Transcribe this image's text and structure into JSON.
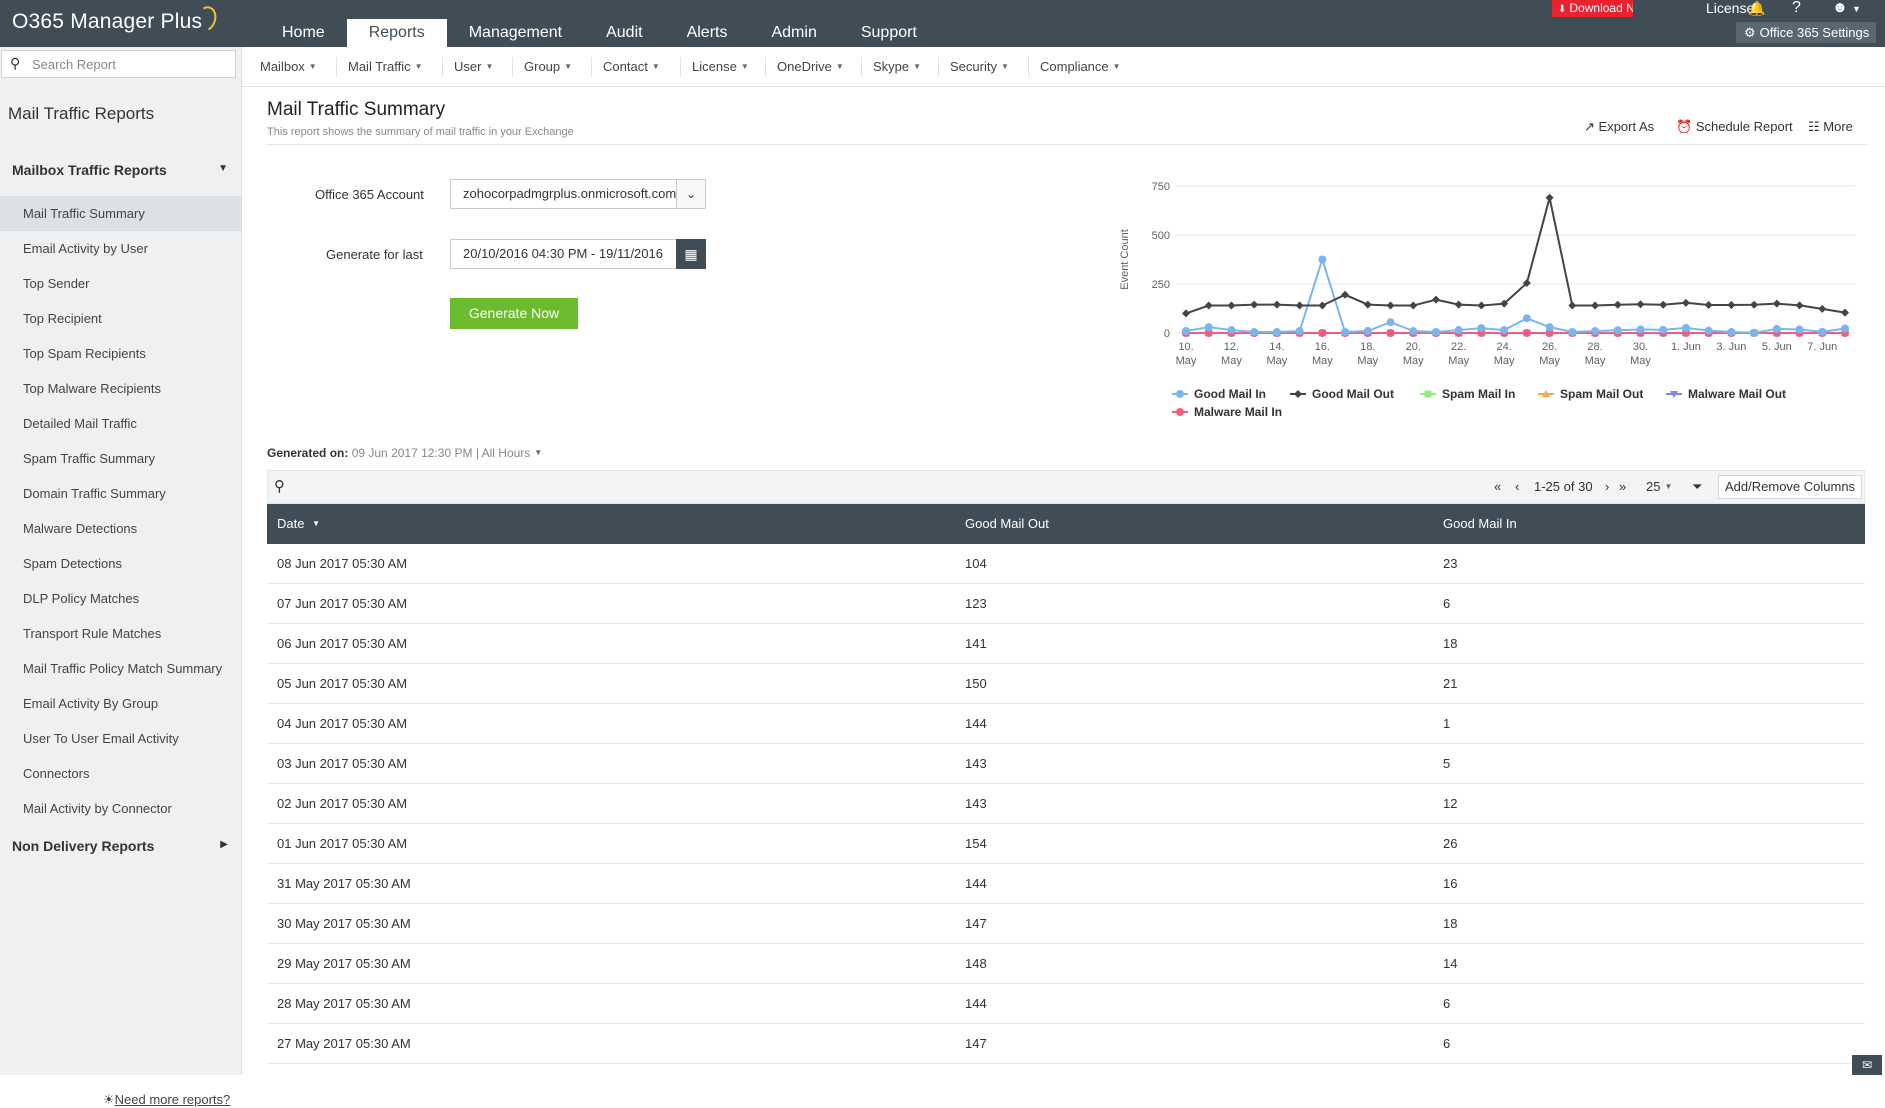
{
  "app": {
    "title": "O365 Manager Plus"
  },
  "topnav": [
    "Home",
    "Reports",
    "Management",
    "Audit",
    "Alerts",
    "Admin",
    "Support"
  ],
  "topnav_active": 1,
  "header_right": {
    "download": "Download Now",
    "license": "License",
    "settings": "Office 365 Settings"
  },
  "subnav": [
    "Mailbox",
    "Mail Traffic",
    "User",
    "Group",
    "Contact",
    "License",
    "OneDrive",
    "Skype",
    "Security",
    "Compliance"
  ],
  "sidebar": {
    "search_placeholder": "Search Report",
    "title": "Mail Traffic Reports",
    "section1": "Mailbox Traffic Reports",
    "items": [
      "Mail Traffic Summary",
      "Email Activity by User",
      "Top Sender",
      "Top Recipient",
      "Top Spam Recipients",
      "Top Malware Recipients",
      "Detailed Mail Traffic",
      "Spam Traffic Summary",
      "Domain Traffic Summary",
      "Malware Detections",
      "Spam Detections",
      "DLP Policy Matches",
      "Transport Rule Matches",
      "Mail Traffic Policy Match Summary",
      "Email Activity By Group",
      "User To User Email Activity",
      "Connectors",
      "Mail Activity by Connector"
    ],
    "active_index": 0,
    "section2": "Non Delivery Reports",
    "need_more": "Need more reports?"
  },
  "report": {
    "title": "Mail Traffic Summary",
    "subtitle": "This report shows the summary of mail traffic in your Exchange",
    "actions": {
      "export": "Export As",
      "schedule": "Schedule Report",
      "more": "More"
    }
  },
  "form": {
    "account_label": "Office 365 Account",
    "account_value": "zohocorpadmgrplus.onmicrosoft.com",
    "period_label": "Generate for last",
    "period_value": "20/10/2016 04:30 PM - 19/11/2016",
    "generate_button": "Generate Now"
  },
  "generated": {
    "label": "Generated on:",
    "value": "09 Jun 2017 12:30 PM",
    "sep": "|",
    "hours": "All Hours"
  },
  "toolbar": {
    "range": "1-25 of 30",
    "page_size": "25",
    "add_columns": "Add/Remove Columns"
  },
  "table": {
    "columns": [
      "Date",
      "Good Mail Out",
      "Good Mail In"
    ],
    "rows": [
      [
        "08 Jun 2017 05:30 AM",
        "104",
        "23"
      ],
      [
        "07 Jun 2017 05:30 AM",
        "123",
        "6"
      ],
      [
        "06 Jun 2017 05:30 AM",
        "141",
        "18"
      ],
      [
        "05 Jun 2017 05:30 AM",
        "150",
        "21"
      ],
      [
        "04 Jun 2017 05:30 AM",
        "144",
        "1"
      ],
      [
        "03 Jun 2017 05:30 AM",
        "143",
        "5"
      ],
      [
        "02 Jun 2017 05:30 AM",
        "143",
        "12"
      ],
      [
        "01 Jun 2017 05:30 AM",
        "154",
        "26"
      ],
      [
        "31 May 2017 05:30 AM",
        "144",
        "16"
      ],
      [
        "30 May 2017 05:30 AM",
        "147",
        "18"
      ],
      [
        "29 May 2017 05:30 AM",
        "148",
        "14"
      ],
      [
        "28 May 2017 05:30 AM",
        "144",
        "6"
      ],
      [
        "27 May 2017 05:30 AM",
        "147",
        "6"
      ]
    ]
  },
  "chart_data": {
    "type": "line",
    "ylabel": "Event Count",
    "ylim": [
      0,
      750
    ],
    "yticks": [
      0,
      250,
      500,
      750
    ],
    "x": [
      "10 May",
      "11 May",
      "12 May",
      "13 May",
      "14 May",
      "15 May",
      "16 May",
      "17 May",
      "18 May",
      "19 May",
      "20 May",
      "21 May",
      "22 May",
      "23 May",
      "24 May",
      "25 May",
      "26 May",
      "27 May",
      "28 May",
      "29 May",
      "30 May",
      "31 May",
      "1 Jun",
      "2 Jun",
      "3 Jun",
      "4 Jun",
      "5 Jun",
      "6 Jun",
      "7 Jun",
      "8 Jun"
    ],
    "xticks": [
      "10.\nMay",
      "12.\nMay",
      "14.\nMay",
      "16.\nMay",
      "18.\nMay",
      "20.\nMay",
      "22.\nMay",
      "24.\nMay",
      "26.\nMay",
      "28.\nMay",
      "30.\nMay",
      "1. Jun",
      "3. Jun",
      "5. Jun",
      "7. Jun"
    ],
    "series": [
      {
        "name": "Good Mail In",
        "color": "#7cb5ec",
        "marker": "circle",
        "values": [
          10,
          30,
          15,
          5,
          5,
          10,
          375,
          5,
          10,
          55,
          10,
          5,
          15,
          25,
          15,
          75,
          30,
          5,
          10,
          14,
          18,
          16,
          26,
          12,
          5,
          1,
          21,
          18,
          6,
          23
        ]
      },
      {
        "name": "Good Mail Out",
        "color": "#434348",
        "marker": "diamond",
        "values": [
          100,
          140,
          140,
          145,
          145,
          140,
          140,
          195,
          145,
          140,
          140,
          170,
          145,
          140,
          150,
          255,
          690,
          140,
          140,
          144,
          147,
          144,
          154,
          143,
          143,
          144,
          150,
          141,
          123,
          104
        ]
      },
      {
        "name": "Spam Mail In",
        "color": "#90ed7d",
        "marker": "square",
        "values": [
          0,
          0,
          0,
          0,
          0,
          0,
          0,
          0,
          0,
          0,
          0,
          0,
          0,
          0,
          0,
          0,
          0,
          0,
          0,
          0,
          0,
          0,
          0,
          0,
          0,
          0,
          0,
          0,
          0,
          0
        ]
      },
      {
        "name": "Spam Mail Out",
        "color": "#f7a35c",
        "marker": "triangle",
        "values": [
          0,
          0,
          0,
          0,
          0,
          0,
          0,
          0,
          0,
          0,
          0,
          0,
          0,
          0,
          0,
          0,
          0,
          0,
          0,
          0,
          0,
          0,
          0,
          0,
          0,
          0,
          0,
          0,
          0,
          0
        ]
      },
      {
        "name": "Malware Mail Out",
        "color": "#8085e9",
        "marker": "triangle-down",
        "values": [
          0,
          0,
          0,
          0,
          0,
          0,
          0,
          0,
          0,
          0,
          0,
          0,
          0,
          0,
          0,
          0,
          0,
          0,
          0,
          0,
          0,
          0,
          0,
          0,
          0,
          0,
          0,
          0,
          0,
          0
        ]
      },
      {
        "name": "Malware Mail In",
        "color": "#f15c80",
        "marker": "circle",
        "values": [
          0,
          0,
          0,
          0,
          0,
          0,
          0,
          0,
          0,
          0,
          0,
          0,
          0,
          0,
          0,
          0,
          0,
          0,
          0,
          0,
          0,
          0,
          0,
          0,
          0,
          0,
          0,
          0,
          0,
          0
        ]
      }
    ],
    "grid": true,
    "legend": "bottom"
  }
}
